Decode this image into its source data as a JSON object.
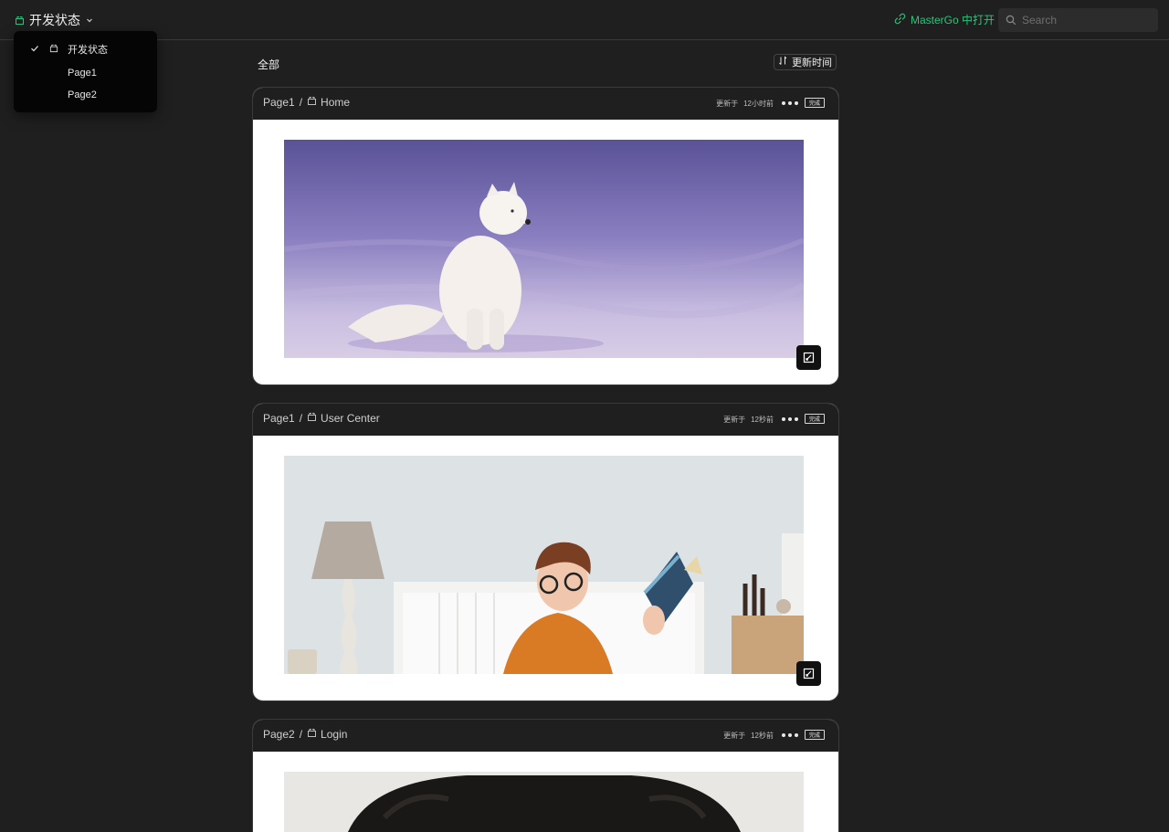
{
  "header": {
    "current_page": "开发状态",
    "open_link": "MasterGo 中打开",
    "search_placeholder": "Search"
  },
  "dropdown": {
    "items": [
      {
        "label": "开发状态",
        "selected": true
      },
      {
        "label": "Page1",
        "selected": false
      },
      {
        "label": "Page2",
        "selected": false
      }
    ]
  },
  "toolbar": {
    "filter_label": "全部",
    "sort_label": "更新时间"
  },
  "cards": [
    {
      "page": "Page1",
      "separator": "/",
      "frame": "Home",
      "updated_prefix": "更新于",
      "updated_time": "12小时前",
      "status": "完成",
      "image": "arctic-fox-in-snow"
    },
    {
      "page": "Page1",
      "separator": "/",
      "frame": "User Center",
      "updated_prefix": "更新于",
      "updated_time": "12秒前",
      "status": "完成",
      "image": "woman-reading-in-bedroom"
    },
    {
      "page": "Page2",
      "separator": "/",
      "frame": "Login",
      "updated_prefix": "更新于",
      "updated_time": "12秒前",
      "status": "完成",
      "image": "dog-closeup"
    }
  ],
  "colors": {
    "background": "#1f1f1f",
    "accent_green": "#2ec37a",
    "card_body": "#ffffff"
  },
  "icons": [
    "frame-icon",
    "chevron-down-icon",
    "link-icon",
    "search-icon",
    "check-icon",
    "sort-icon",
    "more-icon",
    "expand-icon"
  ]
}
